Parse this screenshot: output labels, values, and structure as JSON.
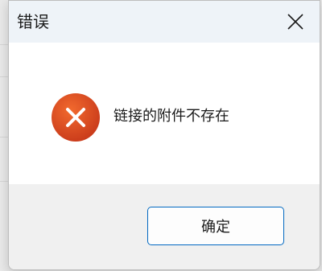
{
  "dialog": {
    "title": "错误",
    "message": "链接的附件不存在",
    "ok_label": "确定"
  },
  "icons": {
    "close": "close-icon",
    "error": "error-icon"
  },
  "colors": {
    "titlebar_bg": "#eef3f8",
    "footer_bg": "#f0f0f0",
    "error_red": "#d9471c",
    "accent_blue": "#0067c0"
  }
}
